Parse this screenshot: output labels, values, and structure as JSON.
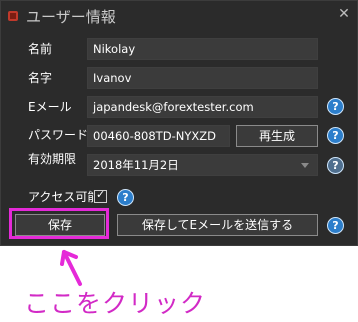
{
  "window": {
    "title": "ユーザー情報",
    "close_glyph": "✕"
  },
  "form": {
    "first_name_label": "名前",
    "first_name_value": "Nikolay",
    "last_name_label": "名字",
    "last_name_value": "Ivanov",
    "email_label": "Eメール",
    "email_value": "japandesk@forextester.com",
    "password_label": "パスワード",
    "password_value": "00460-808TD-NYXZD",
    "regenerate_label": "再生成",
    "expiry_label": "有効期限",
    "expiry_value": "2018年11月2日",
    "access_label": "アクセス可能",
    "access_checked": true,
    "help_glyph": "?",
    "checkmark_glyph": "✓"
  },
  "actions": {
    "save_label": "保存",
    "save_and_send_label": "保存してEメールを送信する"
  },
  "annotation": {
    "text": "ここをクリック",
    "color": "#e52ad8"
  },
  "colors": {
    "window_bg": "#2b2b2b",
    "field_bg": "#3b3b3b",
    "help_blue": "#2c7ecb"
  }
}
